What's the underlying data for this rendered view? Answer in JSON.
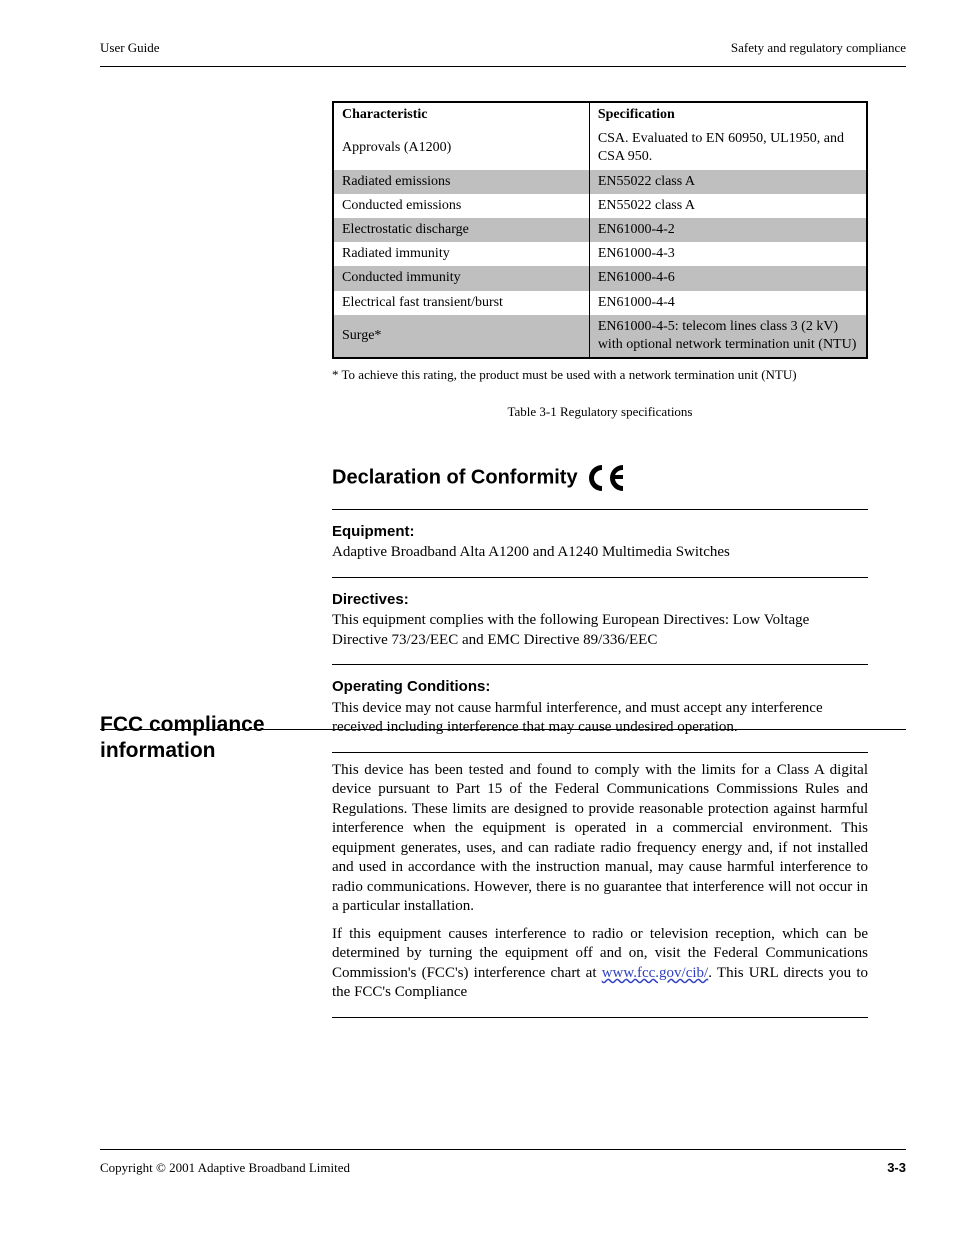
{
  "header": {
    "left": "User Guide",
    "right": "Safety and regulatory compliance"
  },
  "spec_table": {
    "headers": [
      "Characteristic",
      "Specification"
    ],
    "rows": [
      {
        "c0": "Approvals (A1200)",
        "c1": "CSA. Evaluated to EN 60950,\nUL1950, and CSA 950.",
        "shade": false,
        "bottom": false
      },
      {
        "c0": "Radiated emissions",
        "c1": "EN55022 class A",
        "shade": true,
        "bottom": false
      },
      {
        "c0": "Conducted emissions",
        "c1": "EN55022 class A",
        "shade": false,
        "bottom": false
      },
      {
        "c0": "Electrostatic discharge",
        "c1": "EN61000-4-2",
        "shade": true,
        "bottom": false
      },
      {
        "c0": "Radiated immunity",
        "c1": "EN61000-4-3",
        "shade": false,
        "bottom": false
      },
      {
        "c0": "Conducted immunity",
        "c1": "EN61000-4-6",
        "shade": true,
        "bottom": false
      },
      {
        "c0": "Electrical fast transient/burst",
        "c1": "EN61000-4-4",
        "shade": false,
        "bottom": false
      },
      {
        "c0": "Surge*",
        "c1": "EN61000-4-5: telecom lines\nclass 3 (2 kV) with optional\nnetwork termination unit (NTU)",
        "shade": true,
        "bottom": true
      }
    ],
    "footnote": "* To achieve this rating, the product must be used with a network termination unit (NTU)",
    "caption": "Table 3-1  Regulatory specifications"
  },
  "declaration": {
    "heading": "Declaration of Conformity",
    "equipment": {
      "label": "Equipment:",
      "value": "Adaptive Broadband Alta A1200 and A1240 Multimedia Switches"
    },
    "directives": {
      "label": "Directives:",
      "value": "This equipment complies with the following European Directives: Low Voltage Directive 73/23/EEC and EMC Directive 89/336/EEC"
    }
  },
  "fcc": {
    "left_heading": "FCC compliance information",
    "sub1": {
      "label": "Operating Conditions:",
      "value": "This device may not cause harmful interference, and must accept any interference received including interference that may cause undesired operation."
    },
    "body1": "This device has been tested and found to comply with the limits for a Class A digital device pursuant to Part 15 of the Federal Communications Commissions Rules and Regulations. These limits are designed to provide reasonable protection against harmful interference when the equipment is operated in a commercial environment. This equipment generates, uses, and can radiate radio frequency energy and, if not installed and used in accordance with the instruction manual, may cause harmful interference to radio communications. However, there is no guarantee that interference will not occur in a particular installation.",
    "body2_pre": "If this equipment causes interference to radio or television reception, which can be determined by turning the equipment off and on, visit the Federal Communications Commission's (FCC's) interference chart at ",
    "body2_link_text": "www.fcc.gov/cib/",
    "body2_post": ". This URL directs you to the FCC's Compliance"
  },
  "footer": {
    "copyright": "Copyright © 2001 Adaptive Broadband Limited",
    "page": "3-3"
  }
}
